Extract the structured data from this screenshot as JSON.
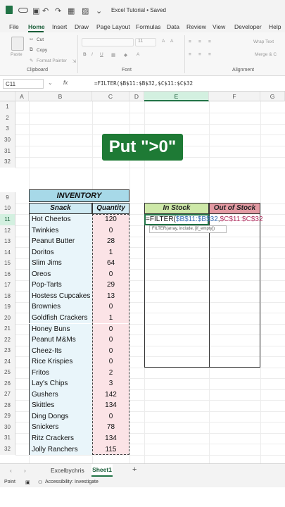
{
  "titlebar": {
    "title": "Excel Tutorial • Saved",
    "autosave_icon": "toggle-icon",
    "save_icon": "save-icon",
    "undo_icon": "undo-icon",
    "redo_icon": "redo-icon",
    "grid_icon": "table-icon",
    "image_icon": "image-icon",
    "dropdown_icon": "chevron-down-icon"
  },
  "ribbon": {
    "tabs": [
      "File",
      "Home",
      "Insert",
      "Draw",
      "Page Layout",
      "Formulas",
      "Data",
      "Review",
      "View",
      "Developer",
      "Help"
    ],
    "active_tab": "Home",
    "clipboard": {
      "paste": "Paste",
      "cut": "Cut",
      "copy": "Copy",
      "format_painter": "Format Painter",
      "group": "Clipboard"
    },
    "font": {
      "size": "11",
      "group": "Font",
      "bold": "B",
      "italic": "I",
      "underline": "U"
    },
    "alignment": {
      "wrap": "Wrap Text",
      "merge": "Merge & C",
      "group": "Alignment"
    }
  },
  "formula_bar": {
    "name_box": "C11",
    "fx": "fx",
    "formula": "=FILTER($B$11:$B$32,$C$11:$C$32"
  },
  "columns": [
    "A",
    "B",
    "C",
    "D",
    "E",
    "F",
    "G"
  ],
  "selected_column": "E",
  "rows": [
    "1",
    "2",
    "3",
    "30",
    "31",
    "32",
    "9",
    "10",
    "11",
    "12",
    "13",
    "14",
    "15",
    "16",
    "17",
    "18",
    "19",
    "20",
    "21",
    "22",
    "23",
    "24",
    "25",
    "26",
    "27",
    "28",
    "29",
    "30",
    "31",
    "32"
  ],
  "selected_row": "11",
  "banner": "Put \">0\"",
  "inventory": {
    "title": "INVENTORY",
    "header_snack": "Snack",
    "header_qty": "Quantity",
    "items": [
      {
        "name": "Hot Cheetos",
        "qty": "120"
      },
      {
        "name": "Twinkies",
        "qty": "0"
      },
      {
        "name": "Peanut Butter",
        "qty": "28"
      },
      {
        "name": "Doritos",
        "qty": "1"
      },
      {
        "name": "Slim Jims",
        "qty": "64"
      },
      {
        "name": "Oreos",
        "qty": "0"
      },
      {
        "name": "Pop-Tarts",
        "qty": "29"
      },
      {
        "name": "Hostess Cupcakes",
        "qty": "13"
      },
      {
        "name": "Brownies",
        "qty": "0"
      },
      {
        "name": "Goldfish Crackers",
        "qty": "1"
      },
      {
        "name": "Honey Buns",
        "qty": "0"
      },
      {
        "name": "Peanut M&Ms",
        "qty": "0"
      },
      {
        "name": "Cheez-Its",
        "qty": "0"
      },
      {
        "name": "Rice Krispies",
        "qty": "0"
      },
      {
        "name": "Fritos",
        "qty": "2"
      },
      {
        "name": "Lay's Chips",
        "qty": "3"
      },
      {
        "name": "Gushers",
        "qty": "142"
      },
      {
        "name": "Skittles",
        "qty": "134"
      },
      {
        "name": "Ding Dongs",
        "qty": "0"
      },
      {
        "name": "Snickers",
        "qty": "78"
      },
      {
        "name": "Ritz Crackers",
        "qty": "134"
      },
      {
        "name": "Jolly Ranchers",
        "qty": "115"
      }
    ]
  },
  "stock": {
    "in_stock": "In Stock",
    "out_of_stock": "Out of Stock",
    "formula_eq": "=FILTER(",
    "formula_r1": "$B$11:$B$32",
    "formula_sep": ",",
    "formula_r2": "$C$11:$C$32",
    "tooltip": "FILTER(array, include, [if_empty])"
  },
  "sheets": {
    "prev_icon": "chevron-left-icon",
    "next_icon": "chevron-right-icon",
    "tabs": [
      "Excelbychris",
      "Sheet1"
    ],
    "active": "Sheet1",
    "add": "+"
  },
  "status": {
    "mode": "Point",
    "accessibility": "Accessibility: Investigate"
  },
  "colors": {
    "excel_green": "#217346",
    "banner_green": "#1e7a35",
    "inventory_blue": "#a7d9e8",
    "in_stock_green": "#cde8a8",
    "out_stock_red": "#e39aa3"
  }
}
